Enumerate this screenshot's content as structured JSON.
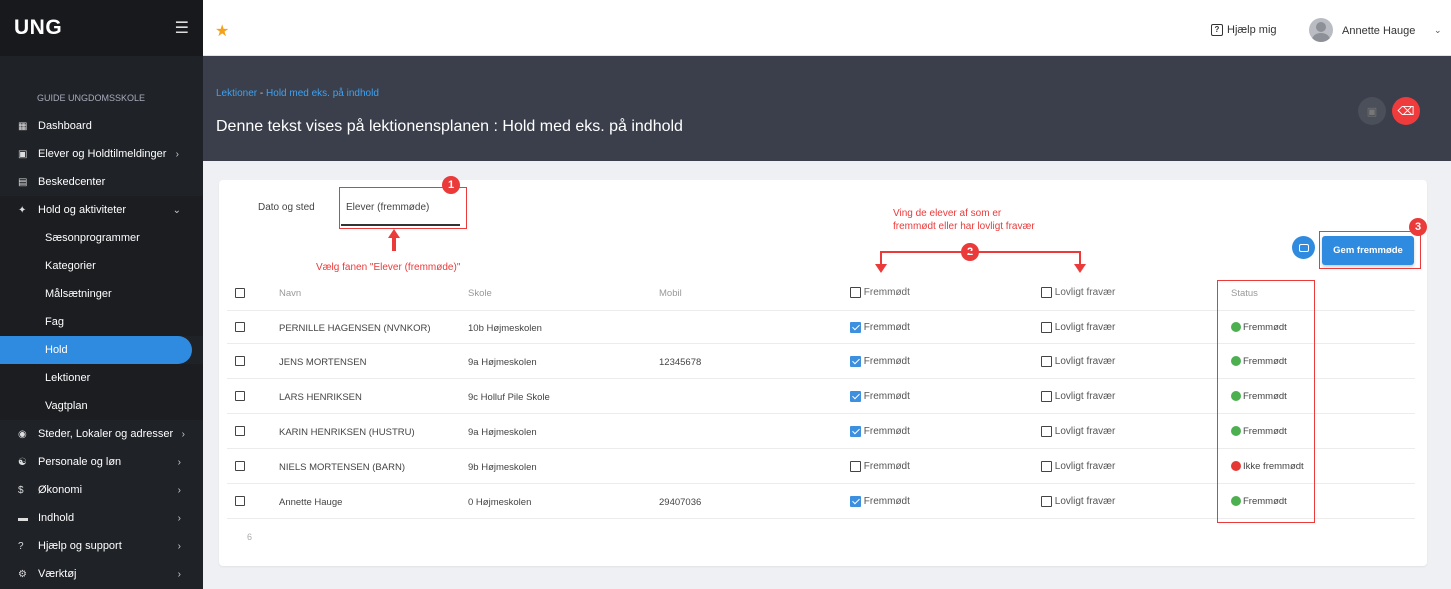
{
  "sidebar": {
    "logo": "UNG",
    "section": "GUIDE UNGDOMSSKOLE",
    "items": [
      {
        "label": "Dashboard",
        "icon": "grid-icon"
      },
      {
        "label": "Elever og Holdtilmeldinger",
        "icon": "id-card-icon",
        "chev": "›"
      },
      {
        "label": "Beskedcenter",
        "icon": "message-icon"
      },
      {
        "label": "Hold og aktiviteter",
        "icon": "run-icon",
        "chev": "⌄"
      },
      {
        "label": "Sæsonprogrammer"
      },
      {
        "label": "Kategorier"
      },
      {
        "label": "Målsætninger"
      },
      {
        "label": "Fag"
      },
      {
        "label": "Hold"
      },
      {
        "label": "Lektioner"
      },
      {
        "label": "Vagtplan"
      },
      {
        "label": "Steder, Lokaler og adresser",
        "icon": "pin-icon",
        "chev": "›"
      },
      {
        "label": "Personale og løn",
        "icon": "people-icon",
        "chev": "›"
      },
      {
        "label": "Økonomi",
        "icon": "dollar-icon",
        "chev": "›"
      },
      {
        "label": "Indhold",
        "icon": "content-icon",
        "chev": "›"
      },
      {
        "label": "Hjælp og support",
        "icon": "help-icon",
        "chev": "›"
      },
      {
        "label": "Værktøj",
        "icon": "tool-icon",
        "chev": "›"
      }
    ]
  },
  "topbar": {
    "help_label": "Hjælp mig",
    "user_name": "Annette Hauge"
  },
  "header": {
    "crumb_root": "Lektioner",
    "crumb_sep": " - ",
    "crumb_current": "Hold med eks. på indhold",
    "title": "Denne tekst vises på lektionensplanen : Hold med eks. på indhold"
  },
  "tabs": [
    "Dato og sted",
    "Elever (fremmøde)"
  ],
  "actions": {
    "save_attendance": "Gem fremmøde"
  },
  "table": {
    "columns": [
      "Navn",
      "Skole",
      "Mobil",
      "Fremmødt",
      "Lovligt fravær",
      "Status"
    ],
    "rows": [
      {
        "name": "PERNILLE HAGENSEN (NVNKOR)",
        "school": "10b Højmeskolen",
        "mobile": "",
        "present": true,
        "present_label": "Fremmødt",
        "excused_label": "Lovligt fravær",
        "status": "Fremmødt",
        "status_color": "#4caf50"
      },
      {
        "name": "JENS MORTENSEN",
        "school": "9a Højmeskolen",
        "mobile": "12345678",
        "present": true,
        "present_label": "Fremmødt",
        "excused_label": "Lovligt fravær",
        "status": "Fremmødt",
        "status_color": "#4caf50"
      },
      {
        "name": "LARS HENRIKSEN",
        "school": "9c Holluf Pile Skole",
        "mobile": "",
        "present": true,
        "present_label": "Fremmødt",
        "excused_label": "Lovligt fravær",
        "status": "Fremmødt",
        "status_color": "#4caf50"
      },
      {
        "name": "KARIN HENRIKSEN (HUSTRU)",
        "school": "9a Højmeskolen",
        "mobile": "",
        "present": true,
        "present_label": "Fremmødt",
        "excused_label": "Lovligt fravær",
        "status": "Fremmødt",
        "status_color": "#4caf50"
      },
      {
        "name": "NIELS MORTENSEN (BARN)",
        "school": "9b Højmeskolen",
        "mobile": "",
        "present": false,
        "present_label": "Fremmødt",
        "excused_label": "Lovligt fravær",
        "status": "Ikke fremmødt",
        "status_color": "#e53935"
      },
      {
        "name": "Annette Hauge",
        "school": "0 Højmeskolen",
        "mobile": "29407036",
        "present": true,
        "present_label": "Fremmødt",
        "excused_label": "Lovligt fravær",
        "status": "Fremmødt",
        "status_color": "#4caf50"
      }
    ],
    "count": "6"
  },
  "annotations": {
    "n1": "1",
    "n2": "2",
    "n3": "3",
    "text1": "Vælg fanen \"Elever (fremmøde)\"",
    "text2_line1": "Ving de elever af som er",
    "text2_line2": "fremmødt eller har lovligt fravær"
  },
  "colors": {
    "accent": "#2f8be0",
    "annotation": "#ea3a3a",
    "sidebar_bg": "#1f2227",
    "header_bg": "#3a3f4b"
  }
}
